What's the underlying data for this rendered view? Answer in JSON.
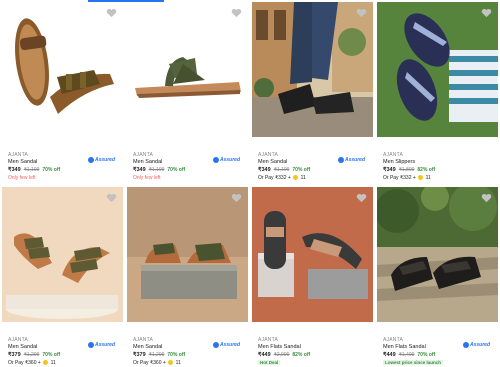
{
  "products": [
    {
      "brand": "AJANTA",
      "name": "Men Sandal",
      "price": "₹349",
      "mrp": "₹1,199",
      "off": "70% off",
      "assured": "Assured",
      "extra": "Only few left",
      "extra_type": "few"
    },
    {
      "brand": "AJANTA",
      "name": "Men Sandal",
      "price": "₹349",
      "mrp": "₹1,199",
      "off": "70% off",
      "assured": "Assured",
      "extra": "Only few left",
      "extra_type": "few"
    },
    {
      "brand": "AJANTA",
      "name": "Men Sandal",
      "price": "₹349",
      "mrp": "₹1,199",
      "off": "70% off",
      "assured": "Assured",
      "extra": "Or Pay ₹332 +",
      "coins": "11",
      "extra_type": "pay"
    },
    {
      "brand": "AJANTA",
      "name": "Men Slippers",
      "price": "₹349",
      "mrp": "₹1,899",
      "off": "82% off",
      "assured": "",
      "extra": "Or Pay ₹332 +",
      "coins": "11",
      "extra_type": "pay"
    },
    {
      "brand": "AJANTA",
      "name": "Men Sandal",
      "price": "₹379",
      "mrp": "₹1,299",
      "off": "70% off",
      "assured": "Assured",
      "extra": "Or Pay ₹360 +",
      "coins": "11",
      "extra_type": "pay"
    },
    {
      "brand": "AJANTA",
      "name": "Men Sandal",
      "price": "₹379",
      "mrp": "₹1,299",
      "off": "70% off",
      "assured": "Assured",
      "extra": "Or Pay ₹360 +",
      "coins": "11",
      "extra_type": "pay"
    },
    {
      "brand": "AJANTA",
      "name": "Men Flats Sandal",
      "price": "₹449",
      "mrp": "₹2,999",
      "off": "82% off",
      "assured": "",
      "extra": "Hot Deal",
      "extra_type": "tag"
    },
    {
      "brand": "AJANTA",
      "name": "Men Flats Sandal",
      "price": "₹449",
      "mrp": "₹1,499",
      "off": "70% off",
      "assured": "Assured",
      "extra": "Lowest price since launch",
      "extra_type": "tag"
    }
  ],
  "colors": {
    "accent": "#2874f0",
    "discount": "#388e3c",
    "few_left": "#ff6161"
  }
}
